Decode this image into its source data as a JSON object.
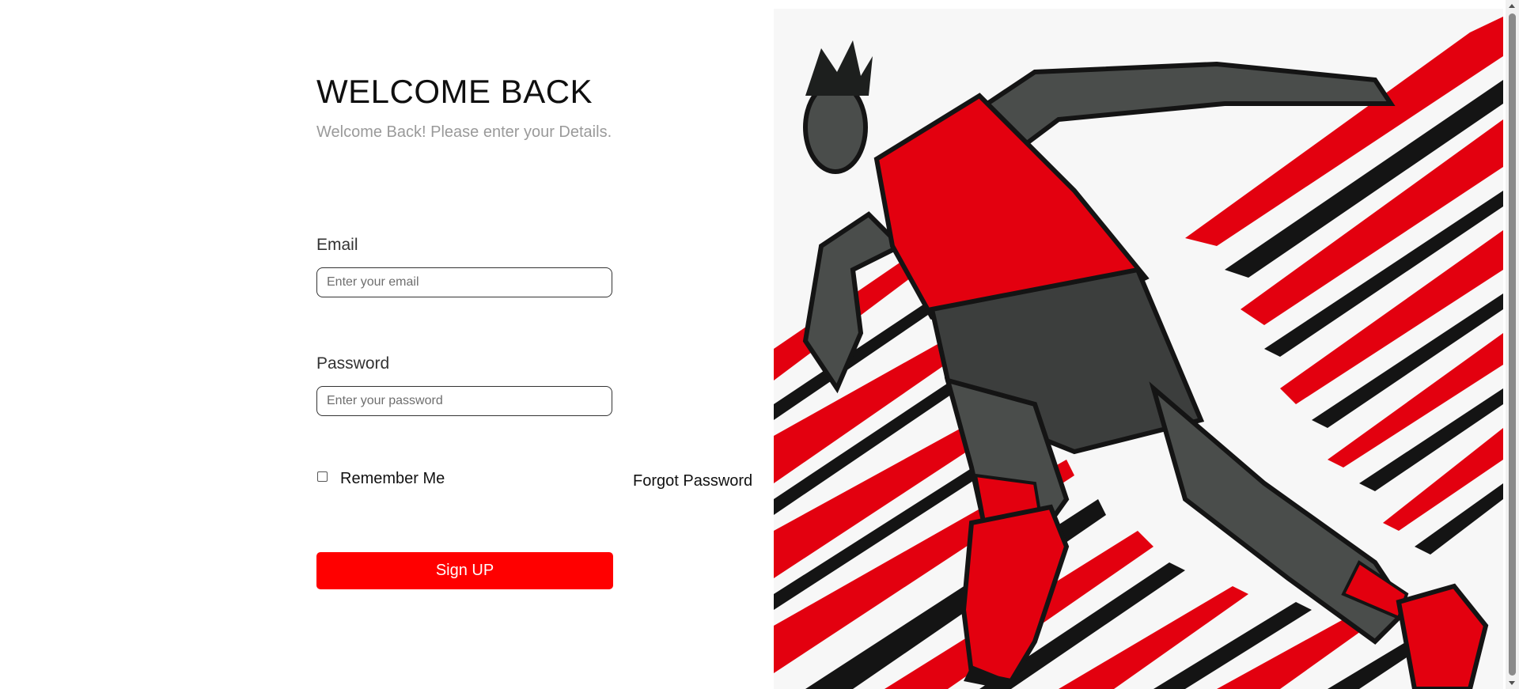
{
  "login": {
    "title": "WELCOME BACK",
    "subtitle": "Welcome Back! Please enter your Details.",
    "email": {
      "label": "Email",
      "value": "",
      "placeholder": "Enter your email"
    },
    "password": {
      "label": "Password",
      "value": "",
      "placeholder": "Enter your password"
    },
    "remember_me": {
      "label": "Remember Me",
      "checked": false
    },
    "forgot_password_label": "Forgot Password",
    "submit_label": "Sign UP"
  },
  "hero": {
    "subject": "sprinter-illustration",
    "colors": {
      "red": "#e3000f",
      "black": "#141414",
      "grey": "#4a4d4b"
    }
  },
  "theme": {
    "accent": "#ff0000",
    "subtitle_color": "#9a9a9a",
    "background": "#ffffff"
  },
  "icons": {
    "scroll_up": "scroll-up-arrow-icon",
    "scroll_down": "scroll-down-arrow-icon"
  }
}
